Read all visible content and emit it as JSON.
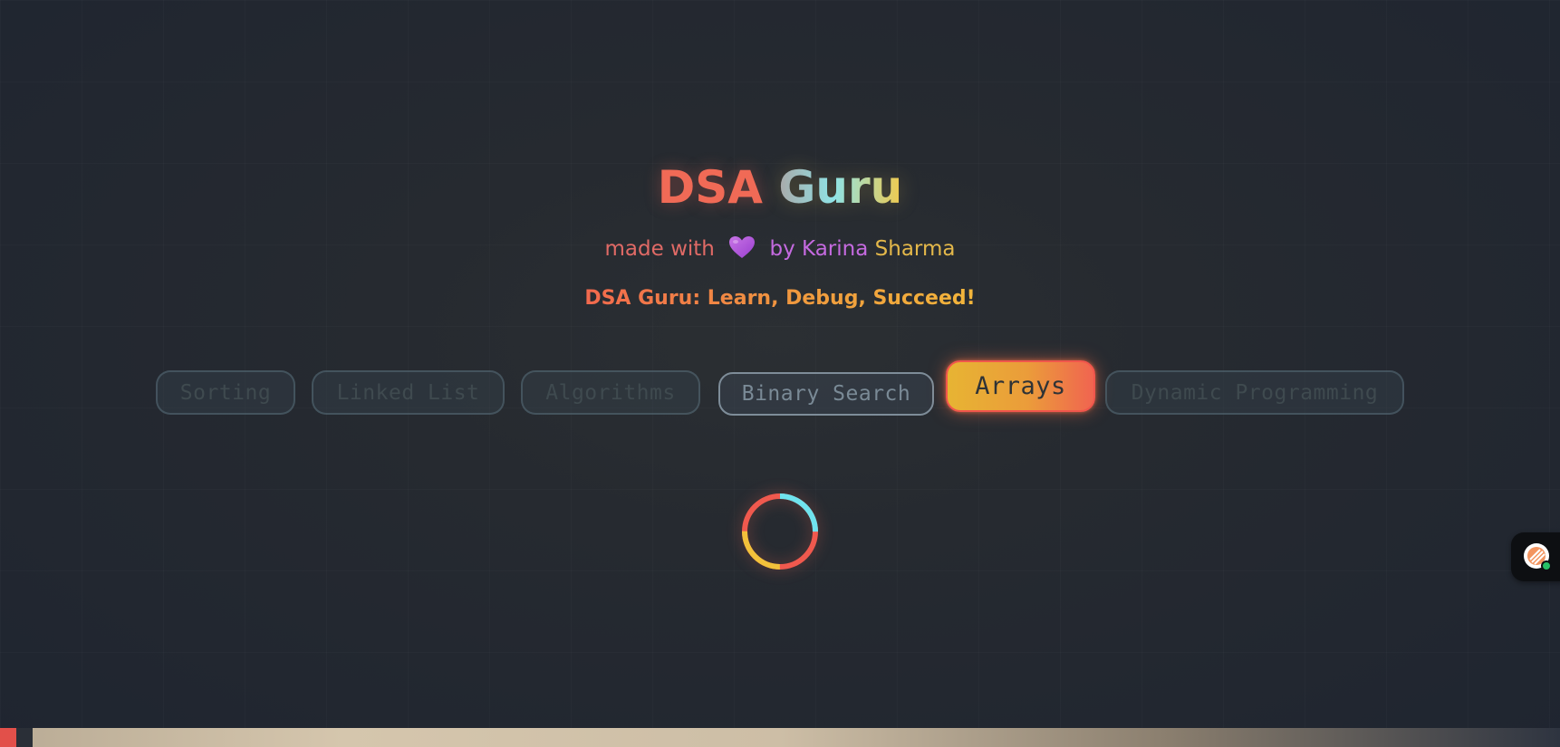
{
  "header": {
    "title_part1": "DSA",
    "title_part2": "Guru",
    "credit": {
      "made_with": "made with",
      "by": "by",
      "name_first": "Karina",
      "name_last": "Sharma",
      "heart_icon": "heart-icon"
    },
    "tagline": "DSA Guru: Learn, Debug, Succeed!"
  },
  "tabs": [
    {
      "label": "Sorting",
      "state": "inactive"
    },
    {
      "label": "Linked List",
      "state": "inactive"
    },
    {
      "label": "Algorithms",
      "state": "inactive"
    },
    {
      "label": "Binary Search",
      "state": "hover"
    },
    {
      "label": "Arrays",
      "state": "active"
    },
    {
      "label": "Dynamic Programming",
      "state": "inactive"
    }
  ],
  "loader": {
    "icon": "loading-spinner-icon"
  },
  "chat_widget": {
    "icon": "chat-avatar-icon",
    "status": "online"
  },
  "colors": {
    "accent_red": "#f06a56",
    "accent_cyan": "#8fe3e6",
    "accent_yellow": "#f1c94c",
    "accent_purple": "#c56ae0",
    "tab_active_gradient_start": "#e7b433",
    "tab_active_gradient_end": "#f06450"
  }
}
